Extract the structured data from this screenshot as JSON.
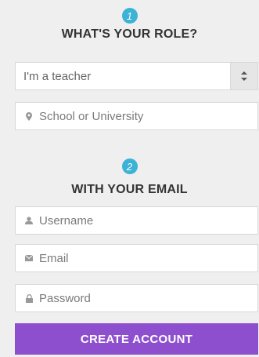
{
  "steps": [
    {
      "number": "1",
      "heading": "WHAT'S YOUR ROLE?"
    },
    {
      "number": "2",
      "heading": "WITH YOUR EMAIL"
    }
  ],
  "role": {
    "selected": "I'm a teacher"
  },
  "school": {
    "placeholder": "School or University",
    "icon": "location-pin-icon"
  },
  "username": {
    "placeholder": "Username",
    "icon": "user-icon"
  },
  "email": {
    "placeholder": "Email",
    "icon": "envelope-icon"
  },
  "password": {
    "placeholder": "Password",
    "icon": "lock-icon"
  },
  "submit": {
    "label": "CREATE ACCOUNT"
  },
  "colors": {
    "accent": "#8e4fcf",
    "step_badge": "#3bb2d6",
    "background": "#efefef"
  }
}
